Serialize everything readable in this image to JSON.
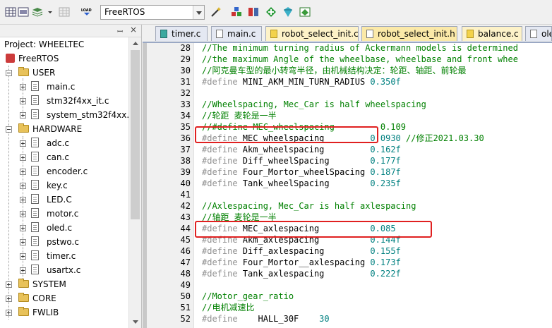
{
  "toolbar": {
    "load_label": "LOAD",
    "target_selected": "FreeRTOS"
  },
  "project_panel": {
    "title": "Project: WHEELTEC",
    "root": "FreeRTOS",
    "groups": [
      {
        "name": "USER",
        "expanded": true,
        "files": [
          "main.c",
          "stm32f4xx_it.c",
          "system_stm32f4xx.c"
        ]
      },
      {
        "name": "HARDWARE",
        "expanded": true,
        "files": [
          "adc.c",
          "can.c",
          "encoder.c",
          "key.c",
          "LED.C",
          "motor.c",
          "oled.c",
          "pstwo.c",
          "timer.c",
          "usartx.c"
        ]
      },
      {
        "name": "SYSTEM",
        "expanded": false,
        "files": []
      },
      {
        "name": "CORE",
        "expanded": false,
        "files": []
      },
      {
        "name": "FWLIB",
        "expanded": false,
        "files": []
      }
    ]
  },
  "tabs": [
    {
      "label": "timer.c",
      "kind": "c",
      "active": false
    },
    {
      "label": "main.c",
      "kind": "c",
      "active": false
    },
    {
      "label": "robot_select_init.c",
      "kind": "c",
      "active": false
    },
    {
      "label": "robot_select_init.h",
      "kind": "h",
      "active": true
    },
    {
      "label": "balance.c",
      "kind": "c",
      "active": false
    },
    {
      "label": "ole",
      "kind": "c",
      "active": false
    }
  ],
  "code_lines": [
    {
      "n": "28",
      "segs": [
        {
          "t": "//The minimum turning radius of Ackermann models is determined",
          "c": "comment"
        }
      ]
    },
    {
      "n": "29",
      "segs": [
        {
          "t": "//the maximum Angle of the wheelbase, wheelbase and front whee",
          "c": "comment"
        }
      ]
    },
    {
      "n": "30",
      "segs": [
        {
          "t": "//阿克曼车型的最小转弯半径，由机械结构决定：轮距、轴距、前轮最",
          "c": "comment"
        }
      ]
    },
    {
      "n": "31",
      "segs": [
        {
          "t": "#define",
          "c": "define"
        },
        {
          "t": " MINI_AKM_MIN_TURN_RADIUS ",
          "c": "plain"
        },
        {
          "t": "0.350f",
          "c": "num"
        }
      ]
    },
    {
      "n": "32",
      "segs": []
    },
    {
      "n": "33",
      "segs": [
        {
          "t": "//Wheelspacing, Mec_Car is half wheelspacing",
          "c": "comment"
        }
      ]
    },
    {
      "n": "34",
      "segs": [
        {
          "t": "//轮距 麦轮是一半",
          "c": "comment"
        }
      ]
    },
    {
      "n": "35",
      "segs": [
        {
          "t": "//#define MEC_wheelspacing         0.109",
          "c": "comment"
        }
      ]
    },
    {
      "n": "36",
      "segs": [
        {
          "t": "#define",
          "c": "define"
        },
        {
          "t": " MEC_wheelspacing         ",
          "c": "plain"
        },
        {
          "t": "0.0930",
          "c": "num"
        },
        {
          "t": " //修正2021.03.30",
          "c": "comment"
        }
      ]
    },
    {
      "n": "37",
      "segs": [
        {
          "t": "#define",
          "c": "define"
        },
        {
          "t": " Akm_wheelspacing         ",
          "c": "plain"
        },
        {
          "t": "0.162f",
          "c": "num"
        }
      ]
    },
    {
      "n": "38",
      "segs": [
        {
          "t": "#define",
          "c": "define"
        },
        {
          "t": " Diff_wheelSpacing        ",
          "c": "plain"
        },
        {
          "t": "0.177f",
          "c": "num"
        }
      ]
    },
    {
      "n": "39",
      "segs": [
        {
          "t": "#define",
          "c": "define"
        },
        {
          "t": " Four_Mortor_wheelSpacing ",
          "c": "plain"
        },
        {
          "t": "0.187f",
          "c": "num"
        }
      ]
    },
    {
      "n": "40",
      "segs": [
        {
          "t": "#define",
          "c": "define"
        },
        {
          "t": " Tank_wheelSpacing        ",
          "c": "plain"
        },
        {
          "t": "0.235f",
          "c": "num"
        }
      ]
    },
    {
      "n": "41",
      "segs": []
    },
    {
      "n": "42",
      "segs": [
        {
          "t": "//Axlespacing, Mec_Car is half axlespacing",
          "c": "comment"
        }
      ]
    },
    {
      "n": "43",
      "segs": [
        {
          "t": "//轴距 麦轮是一半",
          "c": "comment"
        }
      ]
    },
    {
      "n": "44",
      "segs": [
        {
          "t": "#define",
          "c": "define"
        },
        {
          "t": " MEC_axlespacing          ",
          "c": "plain"
        },
        {
          "t": "0.085",
          "c": "num"
        }
      ]
    },
    {
      "n": "45",
      "segs": [
        {
          "t": "#define",
          "c": "define"
        },
        {
          "t": " Akm_axlespacing          ",
          "c": "plain"
        },
        {
          "t": "0.144f",
          "c": "num"
        }
      ]
    },
    {
      "n": "46",
      "segs": [
        {
          "t": "#define",
          "c": "define"
        },
        {
          "t": " Diff_axlespacing         ",
          "c": "plain"
        },
        {
          "t": "0.155f",
          "c": "num"
        }
      ]
    },
    {
      "n": "47",
      "segs": [
        {
          "t": "#define",
          "c": "define"
        },
        {
          "t": " Four_Mortor__axlespacing ",
          "c": "plain"
        },
        {
          "t": "0.173f",
          "c": "num"
        }
      ]
    },
    {
      "n": "48",
      "segs": [
        {
          "t": "#define",
          "c": "define"
        },
        {
          "t": " Tank_axlespacing         ",
          "c": "plain"
        },
        {
          "t": "0.222f",
          "c": "num"
        }
      ]
    },
    {
      "n": "49",
      "segs": []
    },
    {
      "n": "50",
      "segs": [
        {
          "t": "//Motor_gear_ratio",
          "c": "comment"
        }
      ]
    },
    {
      "n": "51",
      "segs": [
        {
          "t": "//电机减速比",
          "c": "comment"
        }
      ]
    },
    {
      "n": "52",
      "segs": [
        {
          "t": "#define",
          "c": "define"
        },
        {
          "t": "    HALL_30F    ",
          "c": "plain"
        },
        {
          "t": "30",
          "c": "num"
        }
      ]
    }
  ],
  "highlight_lines": [
    "36",
    "44"
  ],
  "colors": {
    "comment": "#008000",
    "define": "#909090",
    "number": "#008080",
    "highlight_box": "#e02020",
    "active_tab": "#fbe9a8"
  }
}
